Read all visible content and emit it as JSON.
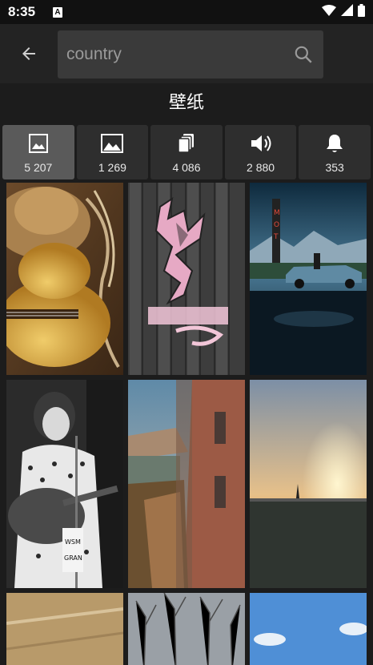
{
  "status_bar": {
    "time": "8:35",
    "notification_glyph": "A",
    "icons": [
      "wifi-icon",
      "signal-icon",
      "battery-icon"
    ]
  },
  "search": {
    "query": "country",
    "placeholder": "country"
  },
  "section": {
    "title": "壁纸"
  },
  "category_tabs": [
    {
      "icon": "image-icon",
      "count": "5 207",
      "active": true
    },
    {
      "icon": "landscape-icon",
      "count": "1 269",
      "active": false
    },
    {
      "icon": "copy-icon",
      "count": "4 086",
      "active": false
    },
    {
      "icon": "volume-icon",
      "count": "2 880",
      "active": false
    },
    {
      "icon": "bell-icon",
      "count": "353",
      "active": false
    }
  ],
  "wallpapers": [
    {
      "description": "guitar-and-cowboy-hat"
    },
    {
      "description": "pink-camo-deer-logo"
    },
    {
      "description": "motel-sign-car-night"
    },
    {
      "description": "vintage-woman-with-guitar"
    },
    {
      "description": "village-canal-houses"
    },
    {
      "description": "sunset-over-field"
    },
    {
      "description": "wood-panel"
    },
    {
      "description": "bare-trees-winter"
    },
    {
      "description": "blue-sky-clouds"
    }
  ],
  "colors": {
    "background": "#1c1c1c",
    "toolbar": "#232323",
    "search_field": "#3a3a3a",
    "tab": "#2e2e2e",
    "tab_active": "#5a5a5a"
  }
}
